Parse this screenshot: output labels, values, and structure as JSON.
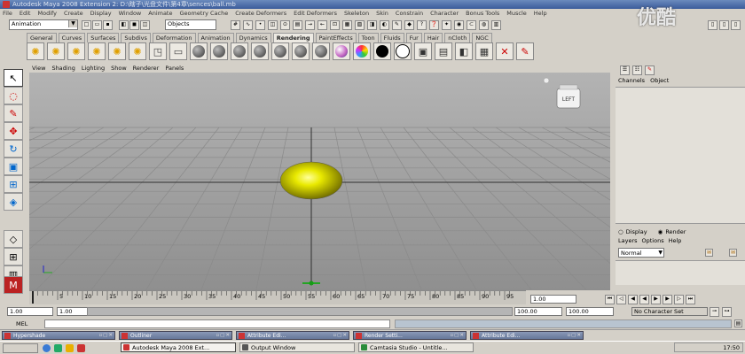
{
  "title_bar": {
    "text": "Autodesk Maya 2008 Extension 2: D:\\瞎子\\光盘文件\\第4章\\sences\\ball.mb"
  },
  "menubar": {
    "items": [
      "File",
      "Edit",
      "Modify",
      "Create",
      "Display",
      "Window",
      "Animate",
      "Geometry Cache",
      "Create Deformers",
      "Edit Deformers",
      "Skeleton",
      "Skin",
      "Constrain",
      "Character",
      "Bonus Tools",
      "Muscle",
      "Help"
    ]
  },
  "status_line": {
    "mode": "Animation",
    "object_field": "Objects"
  },
  "shelf_tabs": {
    "items": [
      "General",
      "Curves",
      "Surfaces",
      "Subdivs",
      "Deformation",
      "Animation",
      "Dynamics",
      "Rendering",
      "PaintEffects",
      "Toon",
      "Fluids",
      "Fur",
      "Hair",
      "nCloth",
      "NGC"
    ],
    "active": "Rendering"
  },
  "shelf_icons": [
    "light-icon",
    "light-icon",
    "light-icon",
    "light-icon",
    "light-icon",
    "light-icon",
    "camera-icon",
    "window-icon",
    "material-sphere-icon",
    "material-sphere-icon",
    "material-sphere-icon",
    "material-sphere-icon",
    "material-sphere-icon",
    "material-sphere-icon",
    "material-sphere-icon",
    "ramp-sphere-icon",
    "rainbow-sphere-icon",
    "black-sphere-icon",
    "outline-sphere-icon",
    "render-view-icon",
    "render-settings-icon",
    "hypershade-icon",
    "ipr-icon",
    "render-icon",
    "batch-render-icon"
  ],
  "panel_menu": {
    "items": [
      "View",
      "Shading",
      "Lighting",
      "Show",
      "Renderer",
      "Panels"
    ]
  },
  "view_cube": {
    "label": "LEFT"
  },
  "channel_box": {
    "menu": [
      "Channels",
      "Object"
    ],
    "display_option": "Display",
    "render_option": "Render",
    "layer_menu": [
      "Layers",
      "Options",
      "Help"
    ],
    "layer_mode": "Normal"
  },
  "time_slider": {
    "ticks": [
      "5",
      "10",
      "15",
      "20",
      "25",
      "30",
      "35",
      "40",
      "45",
      "50",
      "55",
      "60",
      "65",
      "70",
      "75",
      "80",
      "85",
      "90",
      "95",
      "1"
    ],
    "current_frame": "1.00"
  },
  "range_slider": {
    "start_time": "1.00",
    "playback_start": "1.00",
    "playback_end": "100.00",
    "end_time": "100.00",
    "character_set": "No Character Set"
  },
  "command_line": {
    "label": "MEL"
  },
  "floating_windows": [
    {
      "title": "Hypershade"
    },
    {
      "title": "Outliner"
    },
    {
      "title": "Attribute Edi..."
    },
    {
      "title": "Render Setti..."
    },
    {
      "title": "Attribute Edi..."
    }
  ],
  "taskbar": {
    "tasks": [
      "Autodesk Maya 2008 Ext...",
      "Output Window",
      "Camtasia Studio - Untitle..."
    ],
    "time": "17:50"
  },
  "watermark": "优酷",
  "colors": {
    "viewport_bg": "#9e9e9e",
    "sphere": "#e3e300",
    "grid": "#8c8c8c",
    "axis": "#303030"
  }
}
